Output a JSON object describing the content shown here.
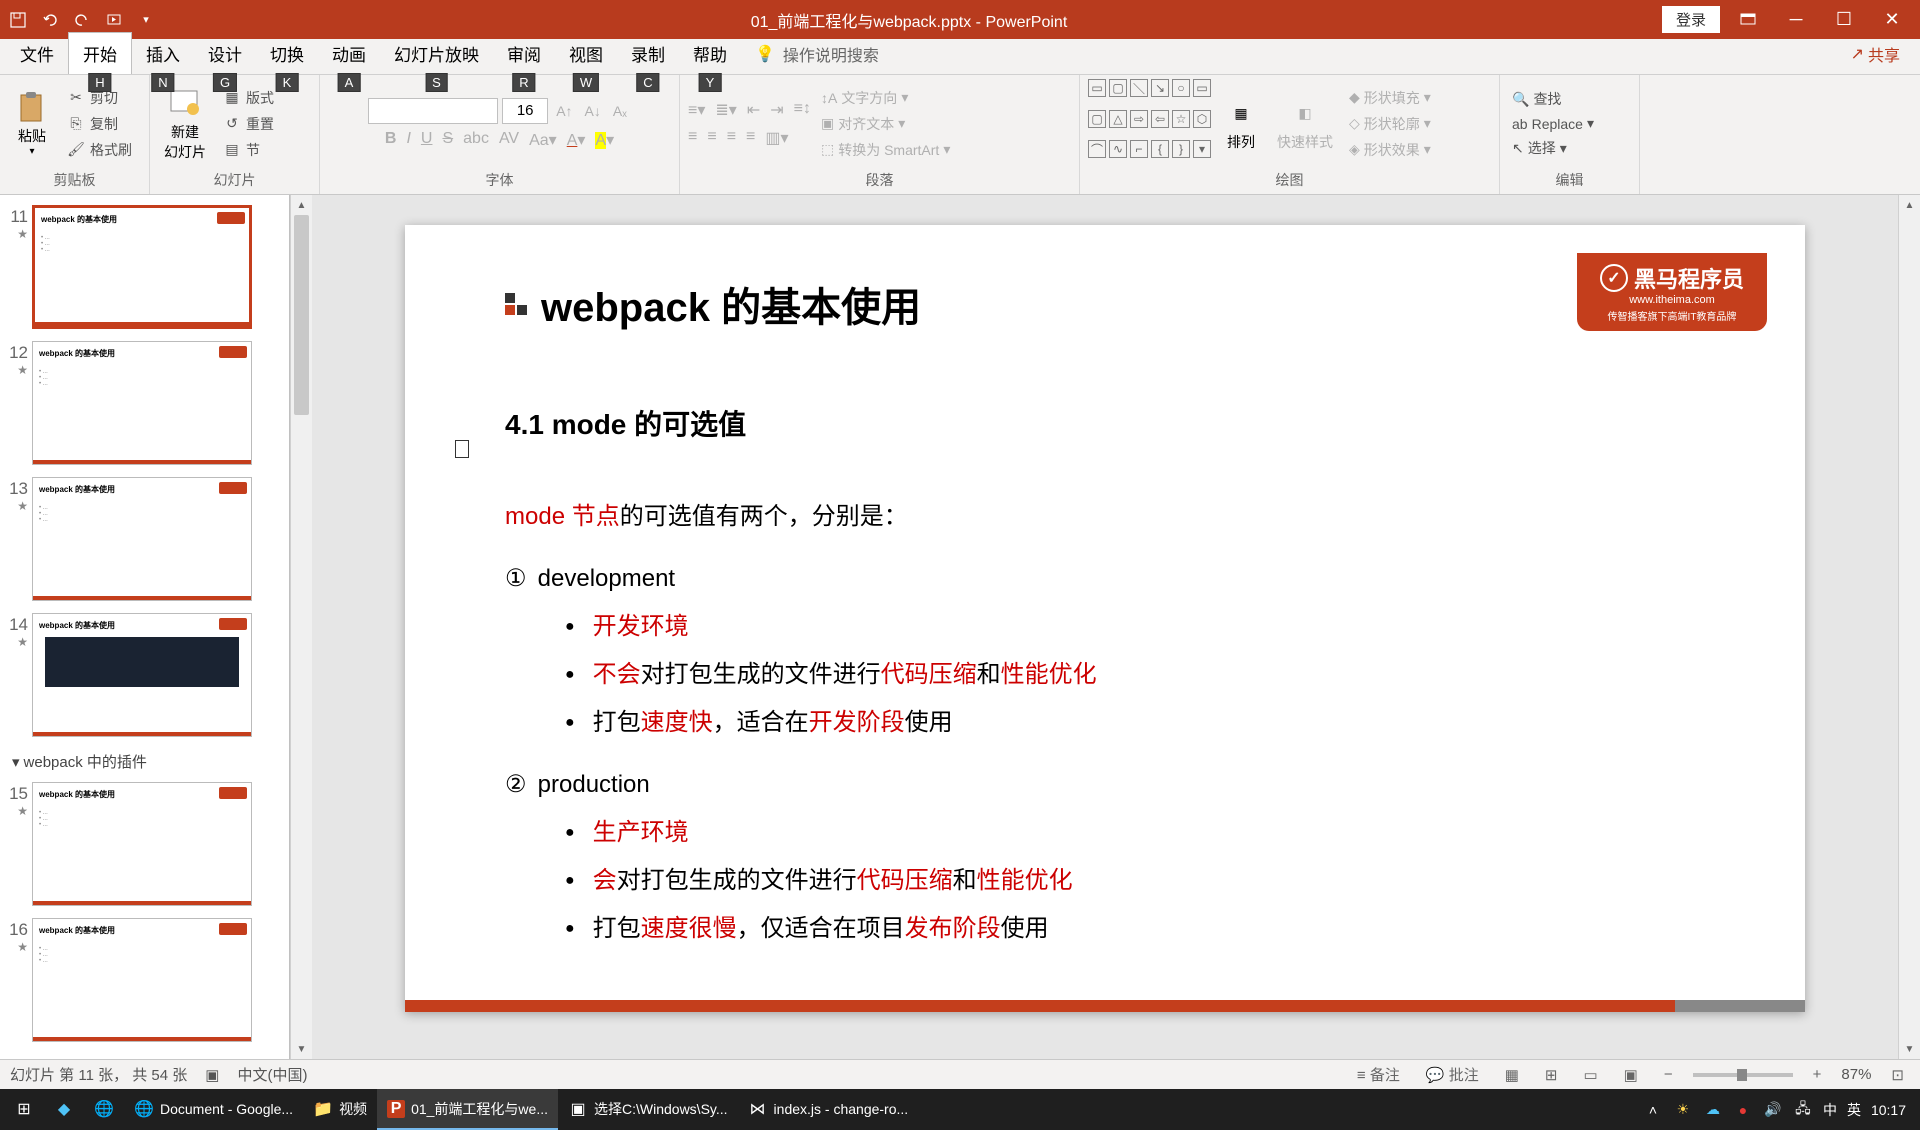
{
  "titlebar": {
    "title": "01_前端工程化与webpack.pptx - PowerPoint",
    "login": "登录"
  },
  "menu": {
    "file": "文件",
    "home": "开始",
    "insert": "插入",
    "design": "设计",
    "transitions": "切换",
    "animations": "动画",
    "slideshow": "幻灯片放映",
    "review": "审阅",
    "view": "视图",
    "record": "录制",
    "help": "帮助",
    "tell_me": "操作说明搜索",
    "share": "共享",
    "keytips": {
      "home": "H",
      "insert": "N",
      "design": "G",
      "transitions": "K",
      "animations": "A",
      "slideshow": "S",
      "review": "R",
      "view": "W",
      "record": "C",
      "help": "Y"
    }
  },
  "ribbon": {
    "clipboard": {
      "label": "剪贴板",
      "paste": "粘贴",
      "cut": "剪切",
      "copy": "复制",
      "format_painter": "格式刷"
    },
    "slides": {
      "label": "幻灯片",
      "new_slide": "新建\n幻灯片",
      "layout": "版式",
      "reset": "重置",
      "section": "节"
    },
    "font": {
      "label": "字体",
      "size": "16"
    },
    "paragraph": {
      "label": "段落",
      "text_direction": "文字方向",
      "align_text": "对齐文本",
      "smartart": "转换为 SmartArt"
    },
    "drawing": {
      "label": "绘图",
      "arrange": "排列",
      "quick_styles": "快速样式",
      "shape_fill": "形状填充",
      "shape_outline": "形状轮廓",
      "shape_effects": "形状效果"
    },
    "editing": {
      "label": "编辑",
      "find": "查找",
      "replace": "Replace",
      "select": "选择"
    }
  },
  "thumbnails": {
    "section_title": "webpack 中的插件",
    "items": [
      {
        "num": "11",
        "selected": true
      },
      {
        "num": "12",
        "selected": false
      },
      {
        "num": "13",
        "selected": false
      },
      {
        "num": "14",
        "selected": false,
        "has_code": true
      },
      {
        "num": "15",
        "selected": false
      },
      {
        "num": "16",
        "selected": false
      }
    ]
  },
  "slide": {
    "title": "webpack 的基本使用",
    "subtitle": "4.1 mode 的可选值",
    "logo_main": "黑马程序员",
    "logo_url": "www.itheima.com",
    "logo_sub": "传智播客旗下高端IT教育品牌",
    "intro_red": "mode 节点",
    "intro_rest": "的可选值有两个，分别是：",
    "items": [
      {
        "num": "①",
        "label": "development",
        "subs": [
          {
            "parts": [
              {
                "t": "开发环境",
                "red": true
              }
            ]
          },
          {
            "parts": [
              {
                "t": "不会",
                "red": true
              },
              {
                "t": "对打包生成的文件进行",
                "red": false
              },
              {
                "t": "代码压缩",
                "red": true
              },
              {
                "t": "和",
                "red": false
              },
              {
                "t": "性能优化",
                "red": true
              }
            ]
          },
          {
            "parts": [
              {
                "t": "打包",
                "red": false
              },
              {
                "t": "速度快",
                "red": true
              },
              {
                "t": "，适合在",
                "red": false
              },
              {
                "t": "开发阶段",
                "red": true
              },
              {
                "t": "使用",
                "red": false
              }
            ]
          }
        ]
      },
      {
        "num": "②",
        "label": "production",
        "subs": [
          {
            "parts": [
              {
                "t": "生产环境",
                "red": true
              }
            ]
          },
          {
            "parts": [
              {
                "t": "会",
                "red": true
              },
              {
                "t": "对打包生成的文件进行",
                "red": false
              },
              {
                "t": "代码压缩",
                "red": true
              },
              {
                "t": "和",
                "red": false
              },
              {
                "t": "性能优化",
                "red": true
              }
            ]
          },
          {
            "parts": [
              {
                "t": "打包",
                "red": false
              },
              {
                "t": "速度很慢",
                "red": true
              },
              {
                "t": "，仅适合在项目",
                "red": false
              },
              {
                "t": "发布阶段",
                "red": true
              },
              {
                "t": "使用",
                "red": false
              }
            ]
          }
        ]
      }
    ]
  },
  "statusbar": {
    "slide_info": "幻灯片 第 11 张， 共 54 张",
    "lang": "中文(中国)",
    "notes": "备注",
    "comments": "批注",
    "zoom": "87%"
  },
  "taskbar": {
    "items": [
      {
        "label": "Document - Google...",
        "icon": "🌐"
      },
      {
        "label": "视频",
        "icon": "📁"
      },
      {
        "label": "01_前端工程化与we...",
        "icon": "P",
        "active": true
      },
      {
        "label": "选择C:\\Windows\\Sy...",
        "icon": "▣"
      },
      {
        "label": "index.js - change-ro...",
        "icon": "⋈"
      }
    ],
    "ime_zh": "中",
    "ime_en": "英",
    "time": "10:17"
  }
}
